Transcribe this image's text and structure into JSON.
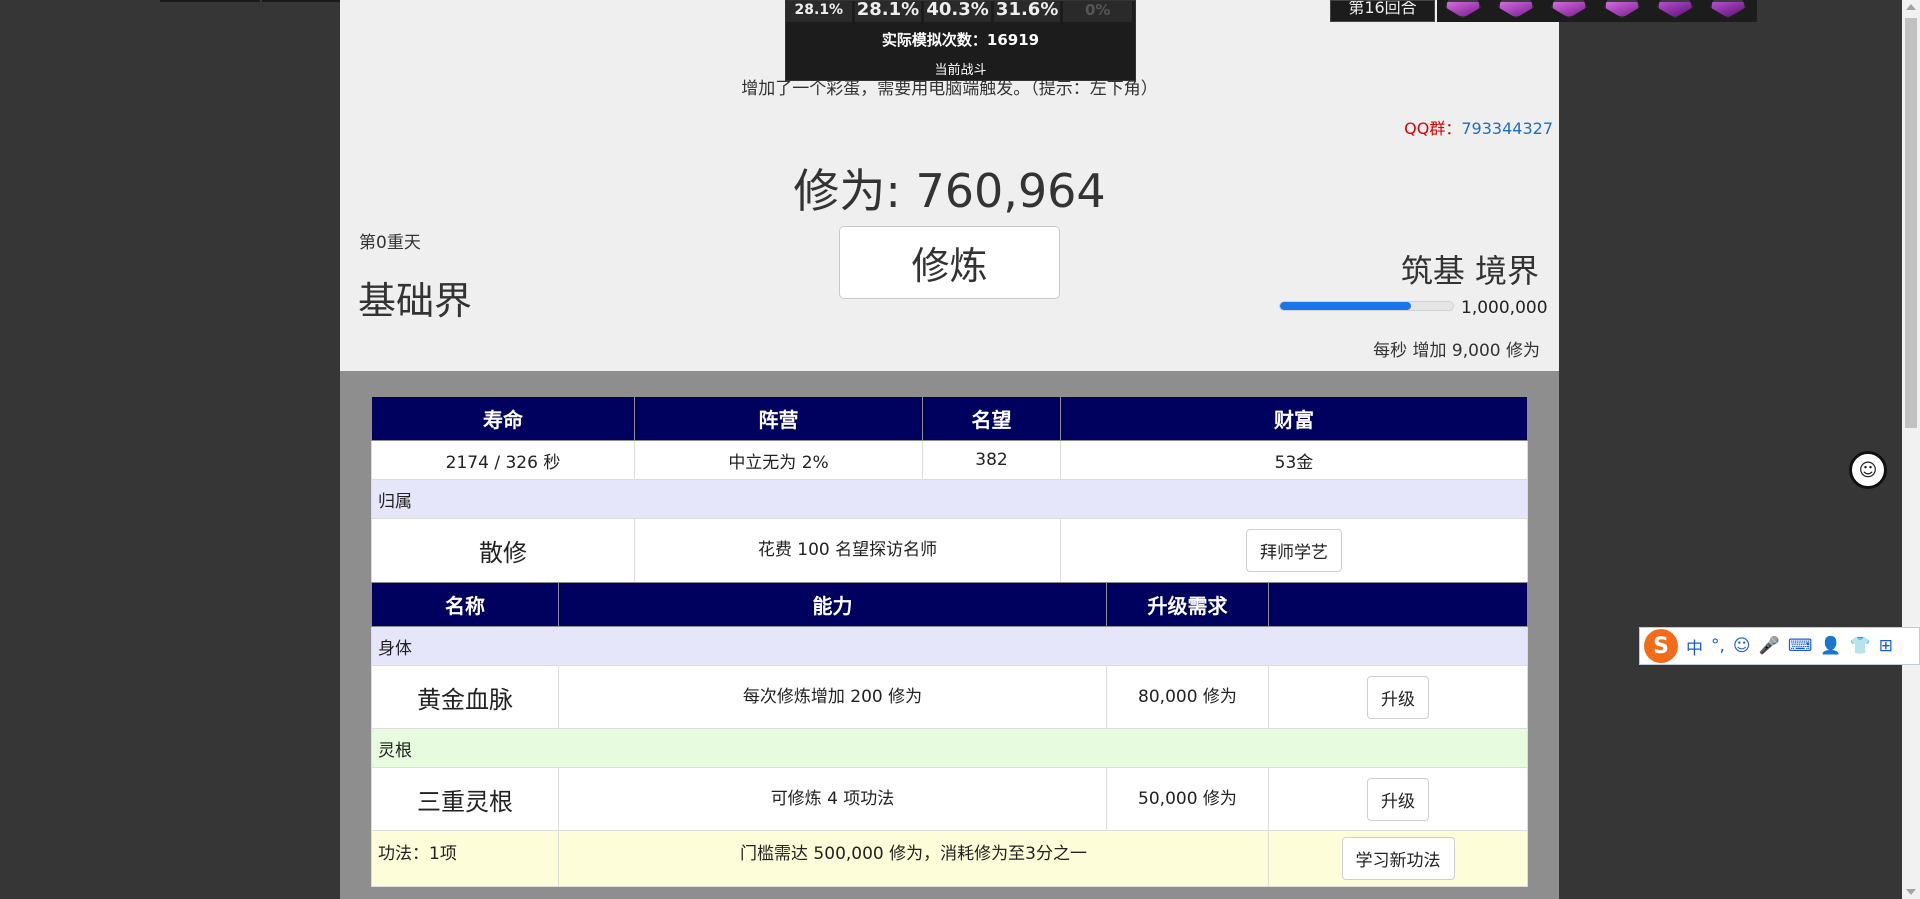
{
  "battle": {
    "pcts": [
      "28.1%",
      "28.1%",
      "40.3%",
      "31.6%",
      "0%"
    ],
    "sim_label": "实际模拟次数：",
    "sim_count": "16919",
    "current": "当前战斗"
  },
  "round": "第16回合",
  "header": {
    "notice": "增加了一个彩蛋，需要用电脑端触发。（提示：左下角）",
    "qq_label": "QQ群：",
    "qq_number": "793344327",
    "cultivation_label": "修为: 760,964",
    "cultivate_button": "修炼",
    "heaven_level": "第0重天",
    "world": "基础界",
    "realm": "筑基 境界",
    "progress_fraction": 0.76,
    "progress_max": "1,000,000",
    "rate": "每秒 增加 9,000 修为"
  },
  "stats": {
    "headers": [
      "寿命",
      "阵营",
      "名望",
      "财富"
    ],
    "values": [
      "2174 / 326 秒",
      "中立无为 2%",
      "382",
      "53金"
    ]
  },
  "affiliation": {
    "section": "归属",
    "name": "散修",
    "desc": "花费 100 名望探访名师",
    "button": "拜师学艺"
  },
  "abilities": {
    "headers": [
      "名称",
      "能力",
      "升级需求",
      ""
    ],
    "body_section": "身体",
    "body": {
      "name": "黄金血脉",
      "desc": "每次修炼增加 200 修为",
      "req": "80,000 修为",
      "button": "升级"
    },
    "root_section": "灵根",
    "root": {
      "name": "三重灵根",
      "desc": "可修炼 4 项功法",
      "req": "50,000 修为",
      "button": "升级"
    },
    "skill_section": "功法：1项",
    "skill_desc": "门槛需达 500,000 修为，消耗修为至3分之一",
    "skill_button": "学习新功法"
  },
  "ime": {
    "logo": "S",
    "items": [
      "中",
      "°,",
      "☺",
      "🎤",
      "⌨",
      "👤",
      "👕",
      "⊞"
    ]
  },
  "colors": {
    "header_bg": "#00005e",
    "progress": "#1976e8",
    "qq": "#e00000"
  }
}
